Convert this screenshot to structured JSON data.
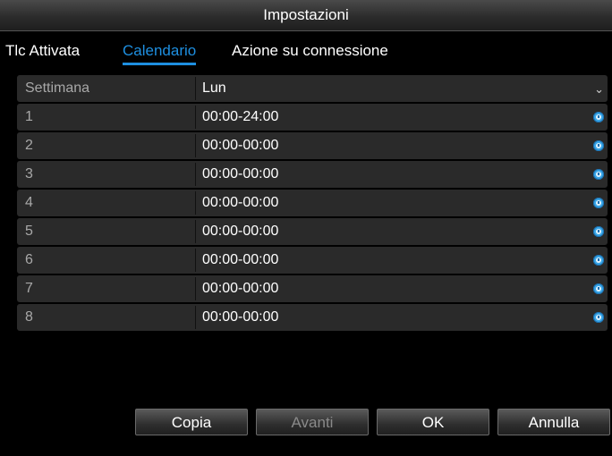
{
  "dialog": {
    "title": "Impostazioni"
  },
  "tabs": [
    {
      "label": "Tlc Attivata",
      "active": false
    },
    {
      "label": "Calendario",
      "active": true
    },
    {
      "label": "Azione su connessione",
      "active": false
    }
  ],
  "schedule": {
    "week_label": "Settimana",
    "week_value": "Lun",
    "rows": [
      {
        "index": "1",
        "time": "00:00-24:00"
      },
      {
        "index": "2",
        "time": "00:00-00:00"
      },
      {
        "index": "3",
        "time": "00:00-00:00"
      },
      {
        "index": "4",
        "time": "00:00-00:00"
      },
      {
        "index": "5",
        "time": "00:00-00:00"
      },
      {
        "index": "6",
        "time": "00:00-00:00"
      },
      {
        "index": "7",
        "time": "00:00-00:00"
      },
      {
        "index": "8",
        "time": "00:00-00:00"
      }
    ]
  },
  "footer": {
    "copy_label": "Copia",
    "next_label": "Avanti",
    "ok_label": "OK",
    "cancel_label": "Annulla"
  },
  "colors": {
    "accent": "#1e8fe0",
    "row_bg": "#2a2a2a",
    "clock": "#3aa7e8"
  },
  "icons": {
    "dropdown": "chevron-down-icon",
    "time": "clock-icon"
  }
}
